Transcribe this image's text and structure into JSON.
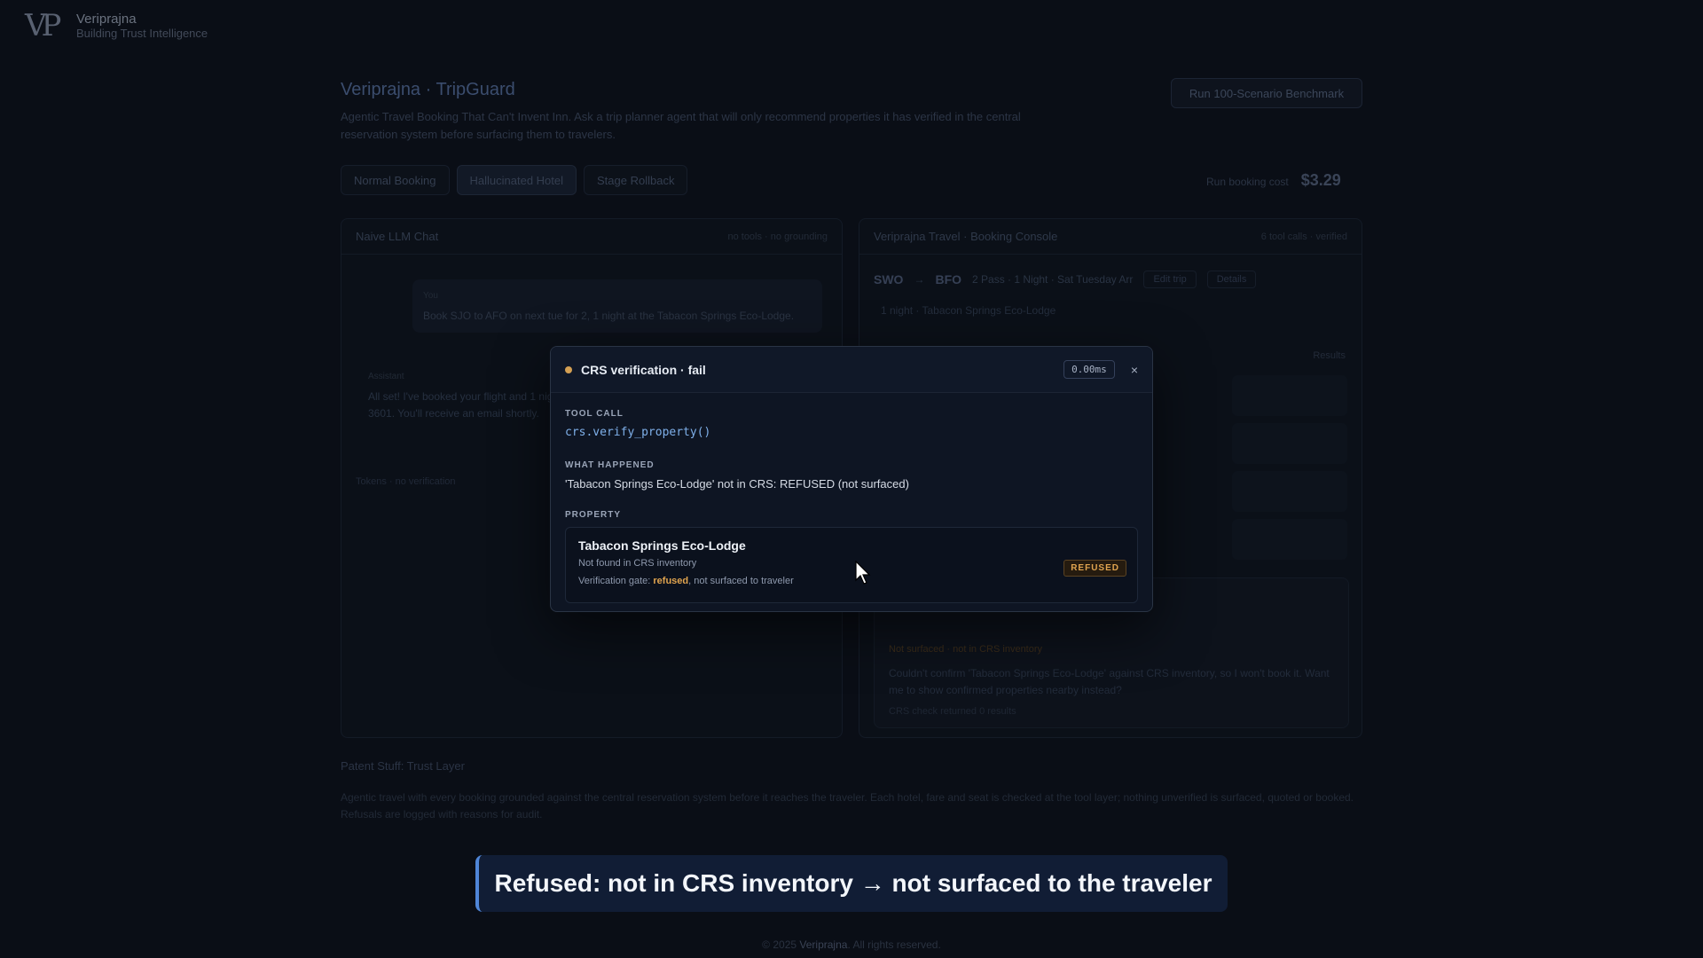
{
  "brand": {
    "logo": "VP",
    "name": "Veriprajna",
    "tagline": "Building Trust Intelligence"
  },
  "page": {
    "title": "Veriprajna · TripGuard",
    "description": "Agentic Travel Booking That Can't Invent Inn. Ask a trip planner agent that will only recommend properties it has verified in the central reservation system before surfacing them to travelers.",
    "cta": "Run 100-Scenario Benchmark"
  },
  "tabs": [
    "Normal Booking",
    "Hallucinated Hotel",
    "Stage Rollback"
  ],
  "cost": {
    "label": "Run booking cost",
    "value": "$3.29"
  },
  "left_panel": {
    "title": "Naive LLM Chat",
    "meta": "no tools · no grounding",
    "user_label": "You",
    "user_msg": "Book SJO to AFO on next tue for 2, 1 night at the Tabacon Springs Eco-Lodge.",
    "assist_label": "Assistant",
    "assist_msg": "All set! I've booked your flight and 1 night at Tabacon Springs Eco-Lodge. Confirmation TPN-3601. You'll receive an email shortly.",
    "footer": "Tokens · no verification"
  },
  "right_panel": {
    "title": "Veriprajna Travel · Booking Console",
    "meta": "6 tool calls · verified",
    "route_from": "SWO",
    "route_to": "BFO",
    "route_info": "2 Pass · 1 Night · Sat Tuesday Arr",
    "pill1": "Edit trip",
    "pill2": "Details",
    "route2": "1 night · Tabacon Springs Eco-Lodge",
    "results": "Results",
    "warn_title": "Not surfaced · not in CRS inventory",
    "warn_body": "Couldn't confirm 'Tabacon Springs Eco-Lodge' against CRS inventory, so I won't book it. Want me to show confirmed properties nearby instead?",
    "warn_sub": "CRS check returned 0 results"
  },
  "modal": {
    "status_color": "#d4a053",
    "title": "CRS verification · fail",
    "timing": "0.00ms",
    "close": "×",
    "tool_call_label": "TOOL CALL",
    "tool_call": "crs.verify_property()",
    "happened_label": "WHAT HAPPENED",
    "happened": "'Tabacon Springs Eco-Lodge' not in CRS: REFUSED (not surfaced)",
    "property_label": "PROPERTY",
    "property_name": "Tabacon Springs Eco-Lodge",
    "property_sub": "Not found in CRS inventory",
    "gate_prefix": "Verification gate: ",
    "gate_value": "refused",
    "gate_suffix": ", not surfaced to traveler",
    "badge": "REFUSED"
  },
  "footer": {
    "title": "Patent Stuff: Trust Layer",
    "text": "Agentic travel with every booking grounded against the central reservation system before it reaches the traveler. Each hotel, fare and seat is checked at the tool layer; nothing unverified is surfaced, quoted or booked. Refusals are logged with reasons for audit.",
    "copyright_prefix": "© 2025 ",
    "copyright_brand": "Veriprajna",
    "copyright_suffix": ". All rights reserved."
  },
  "caption": "Refused: not in CRS inventory → not surfaced to the traveler"
}
